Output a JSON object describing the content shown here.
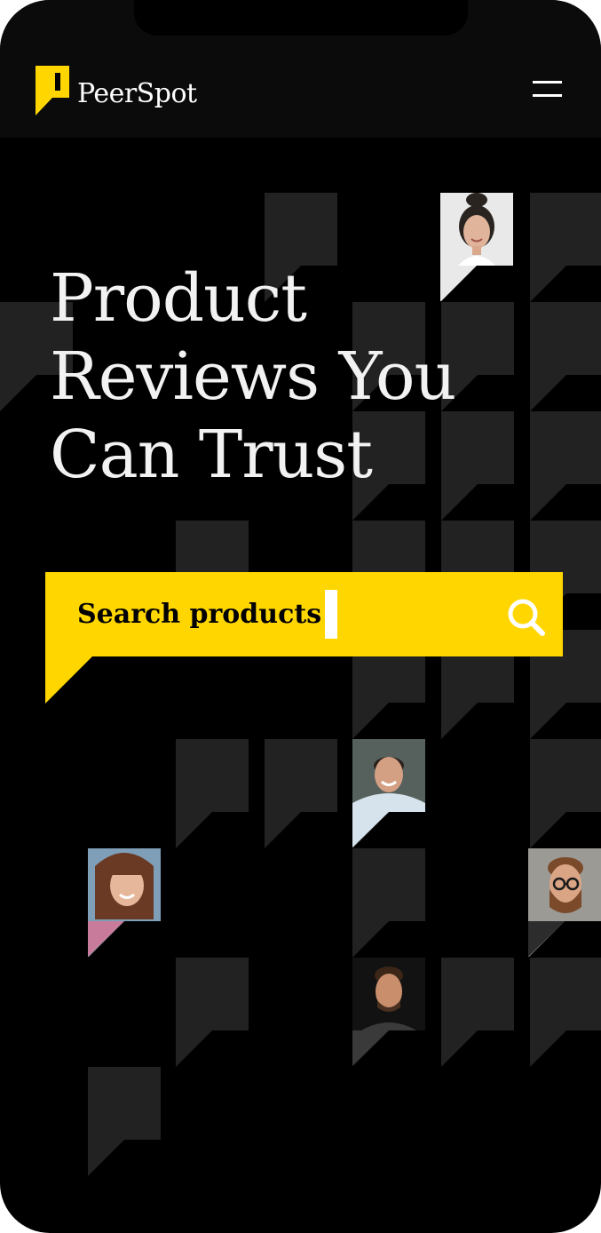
{
  "app": {
    "brand_name": "PeerSpot",
    "brand_color": "#FFD600"
  },
  "header": {
    "menu_icon": "hamburger-menu-icon"
  },
  "hero": {
    "title_lines": [
      "Product",
      "Reviews You",
      "Can Trust"
    ]
  },
  "search": {
    "placeholder": "Search products",
    "icon": "search-icon"
  },
  "colors": {
    "background": "#000000",
    "tile": "#222222",
    "accent": "#FFD600",
    "text": "#F2F2F2"
  }
}
